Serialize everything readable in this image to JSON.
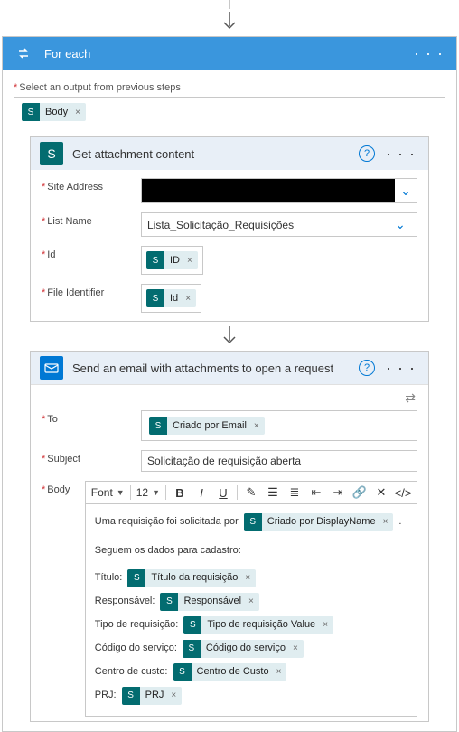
{
  "foreach": {
    "title": "For each",
    "selectLabel": "Select an output from previous steps",
    "token": "Body"
  },
  "attachment": {
    "title": "Get attachment content",
    "fields": {
      "siteAddress": {
        "label": "Site Address"
      },
      "listName": {
        "label": "List Name",
        "value": "Lista_Solicitação_Requisições"
      },
      "id": {
        "label": "Id",
        "token": "ID"
      },
      "fileIdentifier": {
        "label": "File Identifier",
        "token": "Id"
      }
    }
  },
  "email": {
    "title": "Send an email with attachments to open a request",
    "to": {
      "label": "To",
      "token": "Criado por Email"
    },
    "subject": {
      "label": "Subject",
      "value": "Solicitação de requisição aberta"
    },
    "body": {
      "label": "Body",
      "fontLabel": "Font",
      "fontSize": "12",
      "intro": "Uma requisição foi solicitada por",
      "introToken": "Criado por DisplayName",
      "subhead": "Seguem os dados para cadastro:",
      "lines": [
        {
          "label": "Título:",
          "token": "Título da requisição"
        },
        {
          "label": "Responsável:",
          "token": "Responsável"
        },
        {
          "label": "Tipo de requisição:",
          "token": "Tipo de requisição Value"
        },
        {
          "label": "Código do serviço:",
          "token": "Código do serviço"
        },
        {
          "label": "Centro de custo:",
          "token": "Centro de Custo"
        },
        {
          "label": "PRJ:",
          "token": "PRJ"
        }
      ]
    }
  }
}
